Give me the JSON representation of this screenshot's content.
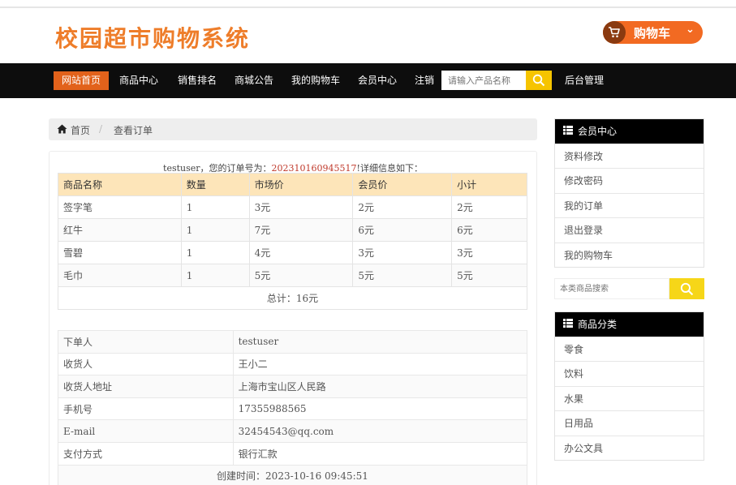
{
  "header": {
    "logo_text": "校园超市购物系统",
    "cart_label": "购物车",
    "cart_chevron": "⌄"
  },
  "nav": {
    "items": [
      "网站首页",
      "商品中心",
      "销售排名",
      "商城公告",
      "我的购物车",
      "会员中心",
      "注销"
    ],
    "search_placeholder": "请输入产品名称",
    "admin_label": "后台管理"
  },
  "breadcrumb": {
    "home": "首页",
    "separator": "/",
    "current": "查看订单"
  },
  "order": {
    "intro_prefix": "testuser，您的订单号为：",
    "order_no": "202310160945517",
    "intro_suffix": "!详细信息如下：",
    "headers": [
      "商品名称",
      "数量",
      "市场价",
      "会员价",
      "小计"
    ],
    "rows": [
      [
        "签字笔",
        "1",
        "3元",
        "2元",
        "2元"
      ],
      [
        "红牛",
        "1",
        "7元",
        "6元",
        "6元"
      ],
      [
        "雪碧",
        "1",
        "4元",
        "3元",
        "3元"
      ],
      [
        "毛巾",
        "1",
        "5元",
        "5元",
        "5元"
      ]
    ],
    "total": "总计：16元"
  },
  "details": {
    "rows": [
      [
        "下单人",
        "testuser"
      ],
      [
        "收货人",
        "王小二"
      ],
      [
        "收货人地址",
        "上海市宝山区人民路"
      ],
      [
        "手机号",
        "17355988565"
      ],
      [
        "E-mail",
        "32454543@qq.com"
      ],
      [
        "支付方式",
        "银行汇款"
      ]
    ],
    "created": "创建时间：2023-10-16 09:45:51"
  },
  "sidebar": {
    "member_title": "会员中心",
    "member_items": [
      "资料修改",
      "修改密码",
      "我的订单",
      "退出登录",
      "我的购物车"
    ],
    "search_placeholder": "本类商品搜索",
    "category_title": "商品分类",
    "category_items": [
      "零食",
      "饮料",
      "水果",
      "日用品",
      "办公文具"
    ]
  },
  "colors": {
    "brand_orange": "#ee7d2a",
    "nav_active": "#e2621b",
    "table_header": "#fde5b9",
    "search_yellow": "#f6c400",
    "order_no_red": "#c0392b"
  },
  "icons": [
    "cart-icon",
    "search-icon",
    "home-icon",
    "list-icon"
  ]
}
